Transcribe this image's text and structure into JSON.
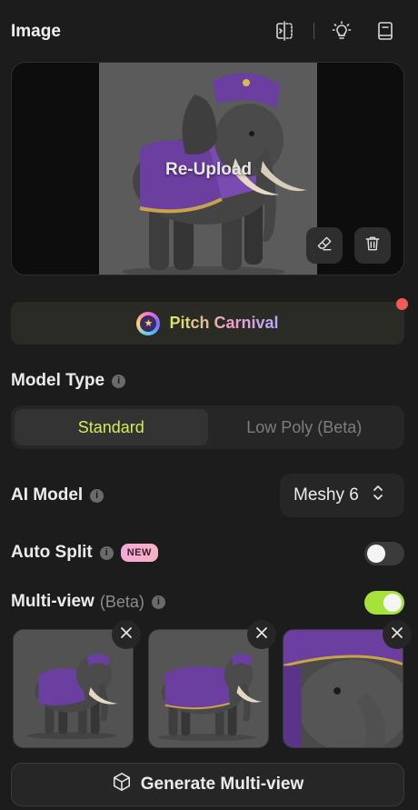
{
  "header": {
    "title": "Image",
    "icons": [
      "compare-icon",
      "lightbulb-icon",
      "book-icon"
    ]
  },
  "image_panel": {
    "overlay_label": "Re-Upload",
    "actions": [
      "eraser-icon",
      "trash-icon"
    ]
  },
  "promo": {
    "label": "Pitch Carnival",
    "has_notification": true,
    "dot_color": "#f25a5a"
  },
  "model_type": {
    "label": "Model Type",
    "options": [
      "Standard",
      "Low Poly (Beta)"
    ],
    "selected": "Standard"
  },
  "ai_model": {
    "label": "AI Model",
    "value": "Meshy 6"
  },
  "auto_split": {
    "label": "Auto Split",
    "badge": "NEW",
    "enabled": false
  },
  "multi_view": {
    "label": "Multi-view",
    "sub_label": "(Beta)",
    "enabled": true,
    "thumbnails": [
      "elephant-front-view",
      "elephant-side-view",
      "elephant-closeup-view"
    ]
  },
  "generate": {
    "label": "Generate Multi-view"
  },
  "colors": {
    "accent": "#d4ec5c",
    "toggle_on": "#a6e23a",
    "background": "#1c1c1c",
    "elephant_blanket": "#6b3fa0"
  }
}
